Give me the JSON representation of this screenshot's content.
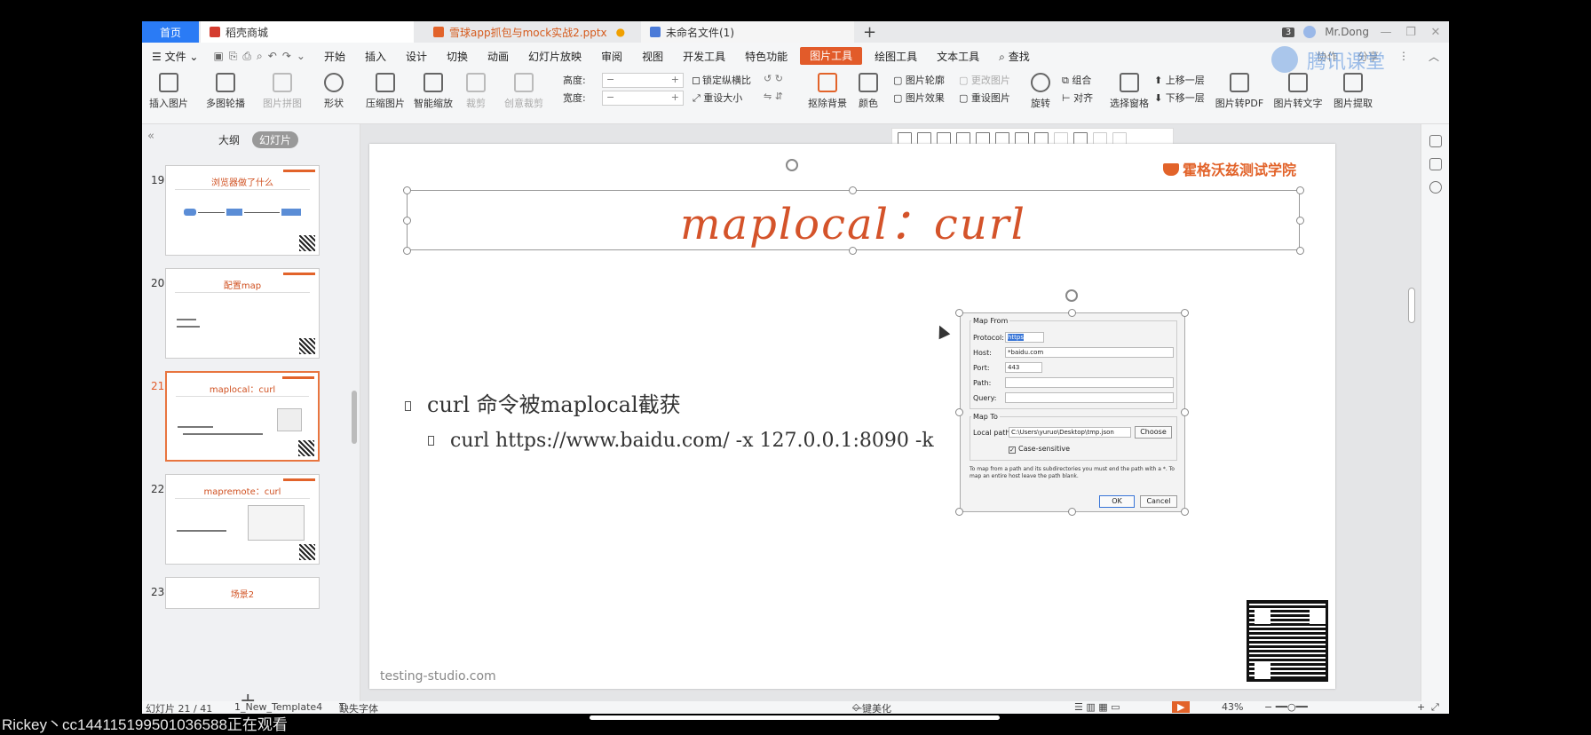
{
  "tabs": {
    "home": "首页",
    "store": "稻壳商城",
    "pptx": "雪球app抓包与mock实战2.pptx",
    "new_file": "未命名文件(1)",
    "new_tab": "+"
  },
  "titlebar": {
    "badge": "3",
    "user": "Mr.Dong"
  },
  "menu": {
    "file": "文件",
    "items": [
      "开始",
      "插入",
      "设计",
      "切换",
      "动画",
      "幻灯片放映",
      "审阅",
      "视图",
      "开发工具",
      "特色功能",
      "图片工具",
      "绘图工具",
      "文本工具"
    ],
    "active_index": 10,
    "search": "查找",
    "right": [
      "协作",
      "分享"
    ]
  },
  "ribbon": {
    "insert_pic": "插入图片",
    "multi_outline": "多图轮播",
    "pic_puzzle": "图片拼图",
    "shape": "形状",
    "compress": "压缩图片",
    "smart_zoom": "智能缩放",
    "crop": "裁剪",
    "creative_crop": "创意裁剪",
    "height_label": "高度:",
    "width_label": "宽度:",
    "lock_ratio": "锁定纵横比",
    "reset_size": "重设大小",
    "remove_bg": "抠除背景",
    "color": "颜色",
    "pic_outline": "图片轮廓",
    "pic_effect": "图片效果",
    "change_pic": "更改图片",
    "reset_pic": "重设图片",
    "rotate": "旋转",
    "combine": "组合",
    "align": "对齐",
    "up_layer": "上移一层",
    "down_layer": "下移一层",
    "select_pane": "选择窗格",
    "to_pdf": "图片转PDF",
    "to_text": "图片转文字",
    "extract": "图片提取"
  },
  "leftpanel": {
    "outline": "大纲",
    "slides": "幻灯片",
    "thumbs": [
      {
        "num": "19",
        "title": "浏览器做了什么"
      },
      {
        "num": "20",
        "title": "配置map"
      },
      {
        "num": "21",
        "title": "maplocal：curl"
      },
      {
        "num": "22",
        "title": "mapremote：curl"
      },
      {
        "num": "23",
        "title": "场景2"
      }
    ],
    "active_index": 2
  },
  "slide": {
    "title": "maplocal：curl",
    "brand": "霍格沃兹测试学院",
    "bullet1": "curl 命令被maplocal截获",
    "bullet2": "curl https://www.baidu.com/ -x 127.0.0.1:8090 -k",
    "footer": "testing-studio.com"
  },
  "dialog": {
    "map_from": "Map From",
    "protocol_label": "Protocol:",
    "protocol_value": "https",
    "host_label": "Host:",
    "host_value": "*baidu.com",
    "port_label": "Port:",
    "port_value": "443",
    "path_label": "Path:",
    "query_label": "Query:",
    "map_to": "Map To",
    "local_path_label": "Local path:",
    "local_path_value": "C:\\Users\\yuruo\\Desktop\\tmp.json",
    "choose": "Choose",
    "case_sensitive": "Case-sensitive",
    "note": "To map from a path and its subdirectories you must end the path with a *. To map an entire host leave the path blank.",
    "ok": "OK",
    "cancel": "Cancel"
  },
  "status": {
    "slide_info": "幻灯片 21 / 41",
    "template": "1_New_Template4",
    "font_missing": "缺失字体",
    "beautify": "一键美化",
    "zoom": "43%"
  },
  "watermark": "腾讯课堂",
  "overlay": "Rickey丶cc14411519950103658​8正在观看"
}
